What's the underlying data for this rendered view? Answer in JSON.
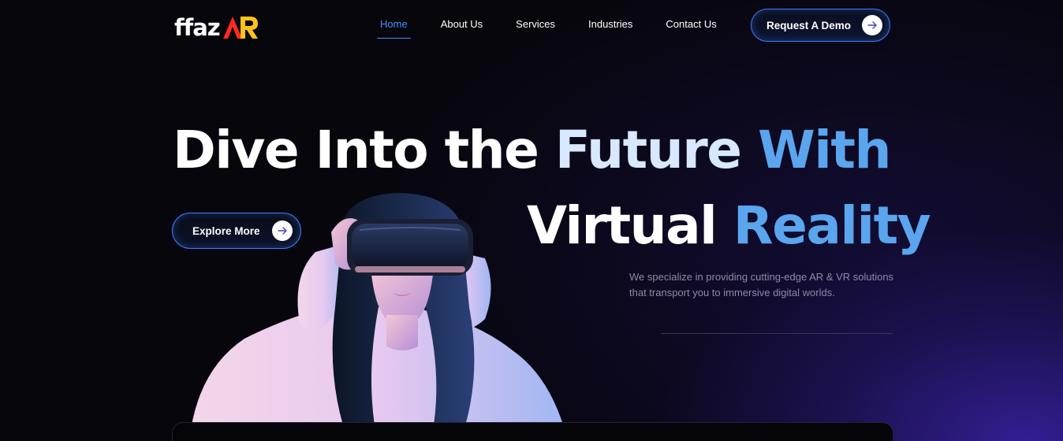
{
  "logo": {
    "text": "ffaz",
    "mark": "AR"
  },
  "nav": {
    "items": [
      {
        "label": "Home",
        "active": true
      },
      {
        "label": "About Us",
        "active": false
      },
      {
        "label": "Services",
        "active": false
      },
      {
        "label": "Industries",
        "active": false
      },
      {
        "label": "Contact Us",
        "active": false
      }
    ],
    "cta_label": "Request A Demo"
  },
  "hero": {
    "line1": {
      "part1": "Dive Into the ",
      "part2": "Future ",
      "part3": "With"
    },
    "line2": {
      "part1": "Virtual ",
      "part2": "Reality"
    },
    "explore_label": "Explore More",
    "description": "We specialize in providing cutting-edge AR & VR solutions that transport you to immersive digital worlds."
  },
  "icons": {
    "cta_arrow": "arrow-right-icon",
    "explore_arrow": "arrow-right-icon"
  },
  "colors": {
    "accent": "#3d7dff",
    "active_nav": "#4a8eff",
    "logo_mark_red": "#ff2a1f",
    "logo_mark_yellow": "#ffc21a",
    "headline_blue": "#5aa5ee"
  }
}
